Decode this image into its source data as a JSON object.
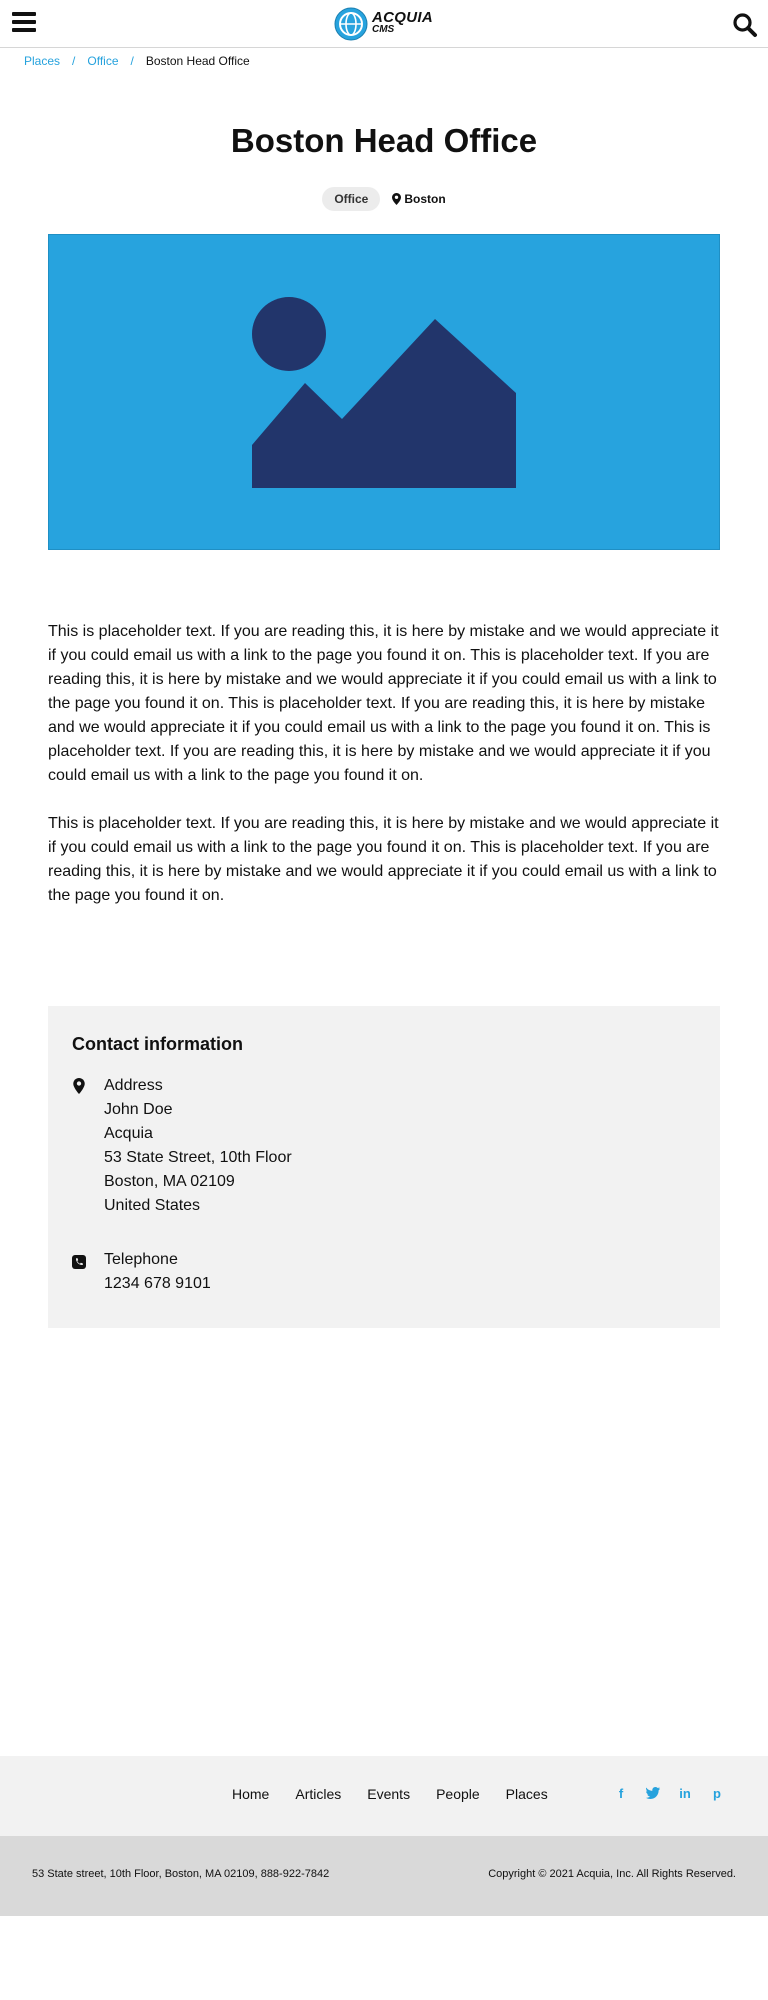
{
  "header": {
    "logo_line1": "ACQUIA",
    "logo_line2": "CMS",
    "icons": {
      "menu": "hamburger-icon",
      "search": "search-icon",
      "logo": "acquia-globe-logo"
    }
  },
  "breadcrumb": {
    "items": [
      {
        "label": "Places"
      },
      {
        "label": "Office"
      }
    ],
    "separator": "/",
    "current": "Boston Head Office"
  },
  "page": {
    "title": "Boston Head Office",
    "tag": "Office",
    "location": "Boston"
  },
  "hero": {
    "background": "#27a3de",
    "shape_color": "#22356b",
    "icon": "image-placeholder-icon"
  },
  "body": {
    "paragraphs": [
      "This is placeholder text. If you are reading this, it is here by mistake and we would appreciate it if you could email us with a link to the page you found it on. This is placeholder text. If you are reading this, it is here by mistake and we would appreciate it if you could email us with a link to the page you found it on. This is placeholder text. If you are reading this, it is here by mistake and we would appreciate it if you could email us with a link to the page you found it on. This is placeholder text. If you are reading this, it is here by mistake and we would appreciate it if you could email us with a link to the page you found it on.",
      "This is placeholder text. If you are reading this, it is here by mistake and we would appreciate it if you could email us with a link to the page you found it on. This is placeholder text. If you are reading this, it is here by mistake and we would appreciate it if you could email us with a link to the page you found it on."
    ]
  },
  "contact": {
    "heading": "Contact information",
    "address": {
      "label": "Address",
      "lines": [
        "John Doe",
        "Acquia",
        "53 State Street, 10th Floor",
        "Boston, MA 02109",
        "United States"
      ]
    },
    "telephone": {
      "label": "Telephone",
      "value": "1234 678 9101"
    }
  },
  "footer": {
    "links": [
      "Home",
      "Articles",
      "Events",
      "People",
      "Places"
    ],
    "social": [
      {
        "icon": "facebook-icon",
        "glyph": "f"
      },
      {
        "icon": "twitter-icon",
        "glyph": "t"
      },
      {
        "icon": "linkedin-icon",
        "glyph": "in"
      },
      {
        "icon": "pinterest-icon",
        "glyph": "p"
      }
    ],
    "address": "53 State street, 10th Floor, Boston, MA 02109, 888-922-7842",
    "copyright": "Copyright © 2021 Acquia, Inc. All Rights Reserved."
  },
  "colors": {
    "accent": "#26a2dd",
    "text": "#111111",
    "card_bg": "#f2f2f2",
    "footer_bottom_bg": "#d9d9d9"
  }
}
